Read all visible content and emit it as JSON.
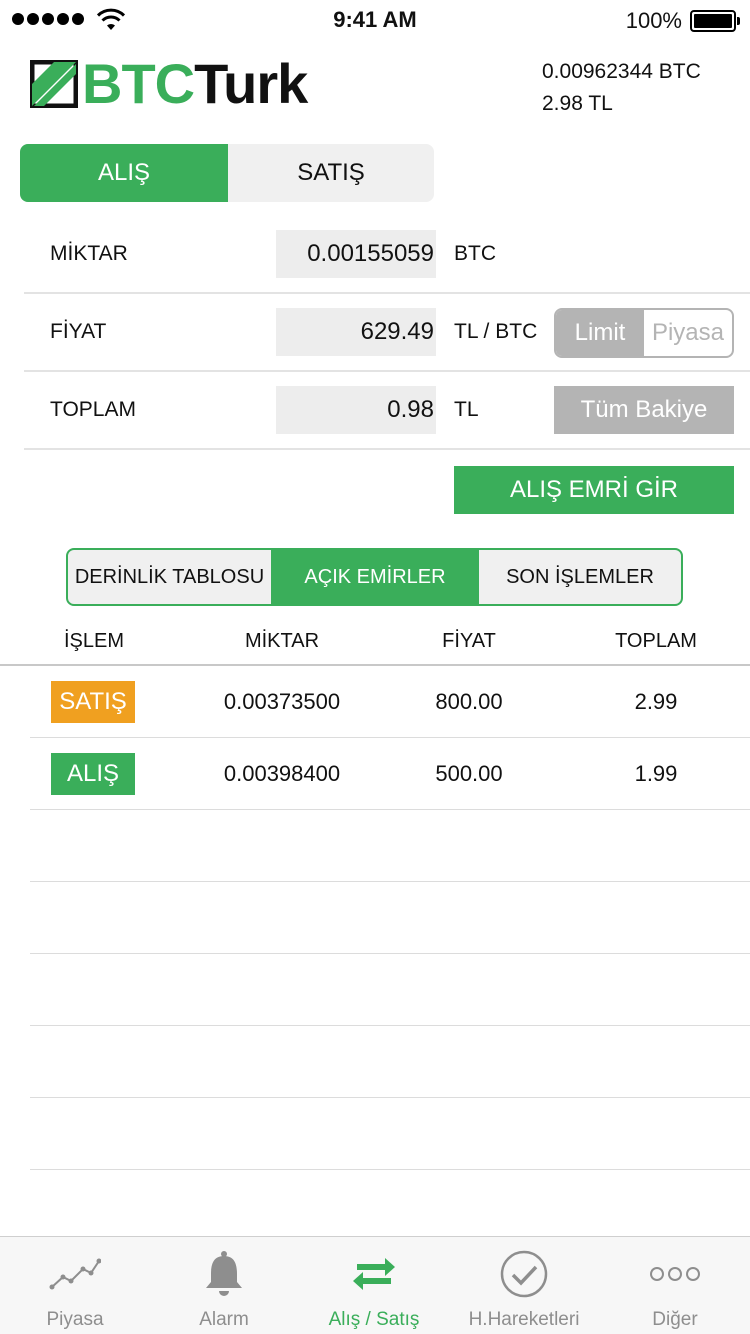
{
  "status_bar": {
    "time": "9:41 AM",
    "battery": "100%"
  },
  "header": {
    "logo_part1": "BTC",
    "logo_part2": "Turk",
    "balance_btc": "0.00962344 BTC",
    "balance_tl": "2.98 TL"
  },
  "trade_tabs": {
    "buy": "ALIŞ",
    "sell": "SATIŞ"
  },
  "form": {
    "amount": {
      "label": "MİKTAR",
      "value": "0.00155059",
      "unit": "BTC"
    },
    "price": {
      "label": "FİYAT",
      "value": "629.49",
      "unit": "TL / BTC"
    },
    "total": {
      "label": "TOPLAM",
      "value": "0.98",
      "unit": "TL"
    },
    "order_type": {
      "limit": "Limit",
      "market": "Piyasa",
      "selected": "Limit"
    },
    "all_balance_label": "Tüm Bakiye",
    "submit_label": "ALIŞ EMRİ GİR"
  },
  "orders_tabs": {
    "depth": "DERİNLİK TABLOSU",
    "open": "AÇIK EMİRLER",
    "last": "SON İŞLEMLER"
  },
  "table": {
    "headers": [
      "İŞLEM",
      "MİKTAR",
      "FİYAT",
      "TOPLAM"
    ],
    "rows": [
      {
        "type": "SATIŞ",
        "amount": "0.00373500",
        "price": "800.00",
        "total": "2.99"
      },
      {
        "type": "ALIŞ",
        "amount": "0.00398400",
        "price": "500.00",
        "total": "1.99"
      }
    ]
  },
  "tab_bar": {
    "items": [
      {
        "label": "Piyasa",
        "icon": "chart-line-icon"
      },
      {
        "label": "Alarm",
        "icon": "bell-icon"
      },
      {
        "label": "Alış / Satış",
        "icon": "exchange-arrows-icon"
      },
      {
        "label": "H.Hareketleri",
        "icon": "checkmark-circle-icon"
      },
      {
        "label": "Diğer",
        "icon": "more-dots-icon"
      }
    ],
    "active_index": 2
  },
  "colors": {
    "brand_green": "#3aae5a",
    "sell_orange": "#f0a020",
    "disabled_gray": "#b4b4b4"
  }
}
